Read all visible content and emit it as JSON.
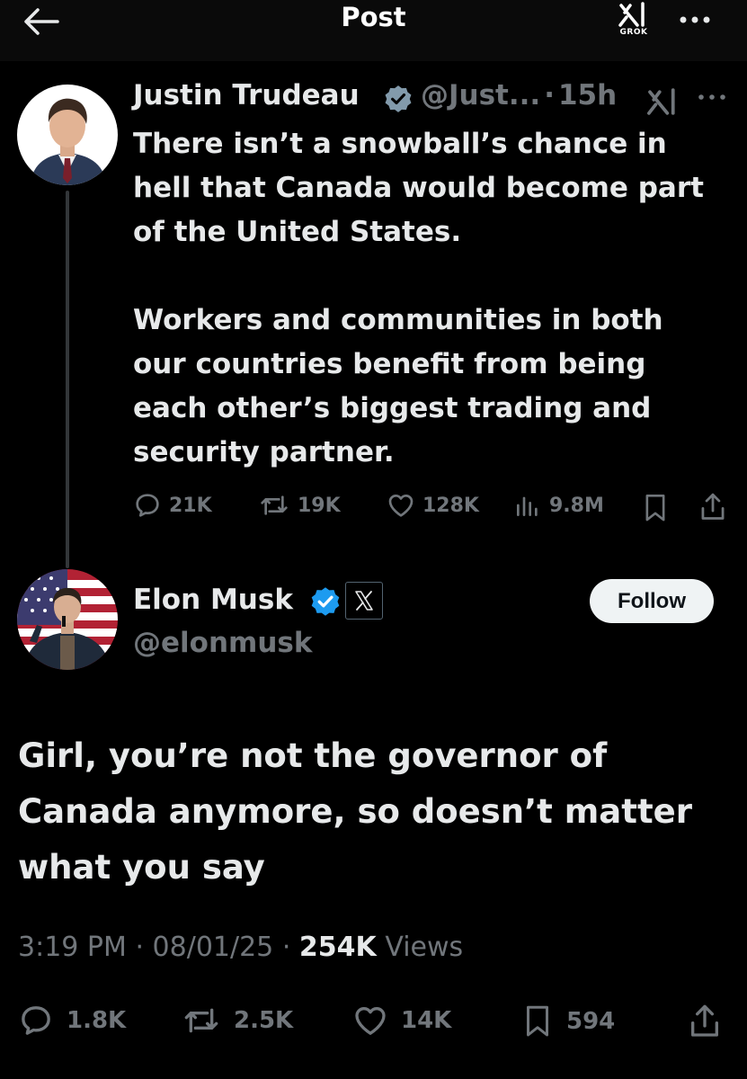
{
  "header": {
    "title": "Post",
    "grok_label": "GROK"
  },
  "parent_post": {
    "author_name": "Justin Trudeau",
    "handle": "@Just...",
    "separator": "·",
    "time": "15h",
    "text_line1": "There isn’t a snowball’s chance in",
    "text_line2": "hell that Canada would become part",
    "text_line3": "of the United States.",
    "text_line4": "Workers and communities in both",
    "text_line5": "our countries benefit from being",
    "text_line6": "each other’s biggest trading and",
    "text_line7": "security partner.",
    "replies": "21K",
    "reposts": "19K",
    "likes": "128K",
    "views": "9.8M"
  },
  "main_post": {
    "author_name": "Elon Musk",
    "handle": "@elonmusk",
    "follow_label": "Follow",
    "text_line1": "Girl, you’re not the governor of",
    "text_line2": "Canada anymore, so doesn’t matter",
    "text_line3": "what you say",
    "time": "3:19 PM",
    "date": "08/01/25",
    "separator": "·",
    "view_count": "254K",
    "views_label": "Views",
    "replies": "1.8K",
    "reposts": "2.5K",
    "likes": "14K",
    "bookmarks": "594"
  },
  "colors": {
    "background": "#000000",
    "text": "#e7e9ea",
    "muted": "#71767b",
    "verified": "#1d9bf0"
  }
}
